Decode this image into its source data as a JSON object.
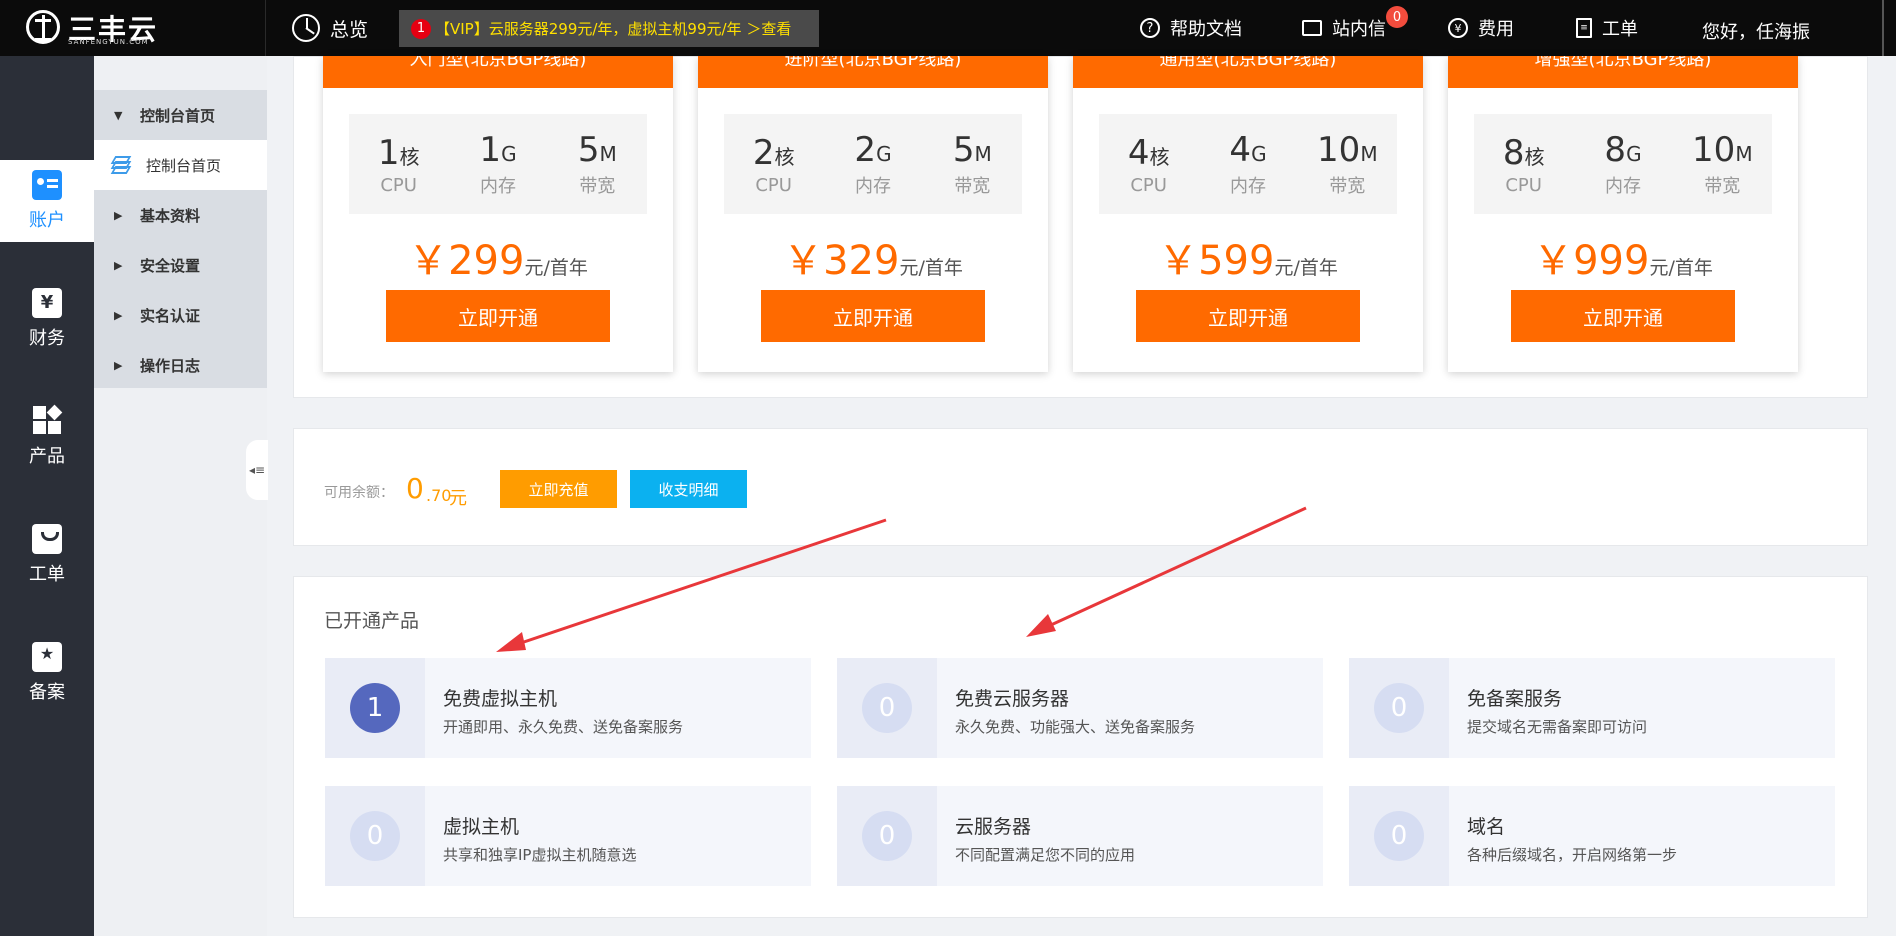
{
  "topbar": {
    "logo_text": "三丰云",
    "logo_sub": "SANFENGYUN.COM",
    "overview": "总览",
    "notice": {
      "badge": "1",
      "text": "【VIP】云服务器299元/年，虚拟主机99元/年 ＞查看"
    },
    "help": "帮助文档",
    "messages": "站内信",
    "messages_badge": "0",
    "fees": "费用",
    "tickets": "工单",
    "greeting": "您好，任海振",
    "icons": {
      "help": "help-circle-icon",
      "messages": "mail-icon",
      "fees": "yen-circle-icon",
      "tickets": "document-icon",
      "overview": "pie-chart-icon"
    }
  },
  "rail": [
    {
      "label": "账户",
      "icon": "account-card-icon",
      "active": true
    },
    {
      "label": "财务",
      "icon": "yen-wallet-icon",
      "active": false
    },
    {
      "label": "产品",
      "icon": "product-grid-icon",
      "active": false
    },
    {
      "label": "工单",
      "icon": "ticket-bag-icon",
      "active": false
    },
    {
      "label": "备案",
      "icon": "record-star-icon",
      "active": false
    }
  ],
  "submenu": {
    "header": "控制台首页",
    "items": [
      "控制台首页",
      "基本资料",
      "安全设置",
      "实名认证",
      "操作日志"
    ]
  },
  "plans": [
    {
      "title": "入门型(北京BGP线路)",
      "cpu": "1",
      "cpu_unit": "核",
      "mem": "1",
      "mem_unit": "G",
      "bw": "5",
      "bw_unit": "M",
      "price": "299"
    },
    {
      "title": "进阶型(北京BGP线路)",
      "cpu": "2",
      "cpu_unit": "核",
      "mem": "2",
      "mem_unit": "G",
      "bw": "5",
      "bw_unit": "M",
      "price": "329"
    },
    {
      "title": "通用型(北京BGP线路)",
      "cpu": "4",
      "cpu_unit": "核",
      "mem": "4",
      "mem_unit": "G",
      "bw": "10",
      "bw_unit": "M",
      "price": "599"
    },
    {
      "title": "增强型(北京BGP线路)",
      "cpu": "8",
      "cpu_unit": "核",
      "mem": "8",
      "mem_unit": "G",
      "bw": "10",
      "bw_unit": "M",
      "price": "999"
    }
  ],
  "plan_labels": {
    "cpu": "CPU",
    "mem": "内存",
    "bw": "带宽",
    "currency": "￥",
    "per": "元/首年",
    "button": "立即开通"
  },
  "balance": {
    "label": "可用余额：",
    "int": "0",
    "dec": ".70",
    "unit": "元",
    "recharge": "立即充值",
    "details": "收支明细"
  },
  "products_title": "已开通产品",
  "products": [
    {
      "count": "1",
      "title": "免费虚拟主机",
      "desc": "开通即用、永久免费、送免备案服务"
    },
    {
      "count": "0",
      "title": "免费云服务器",
      "desc": "永久免费、功能强大、送免备案服务"
    },
    {
      "count": "0",
      "title": "免备案服务",
      "desc": "提交域名无需备案即可访问"
    },
    {
      "count": "0",
      "title": "虚拟主机",
      "desc": "共享和独享IP虚拟主机随意选"
    },
    {
      "count": "0",
      "title": "云服务器",
      "desc": "不同配置满足您不同的应用"
    },
    {
      "count": "0",
      "title": "域名",
      "desc": "各种后缀域名，开启网络第一步"
    }
  ],
  "colors": {
    "accent": "#ff6a00",
    "active_blue": "#1e90ff",
    "recharge": "#ff9c00",
    "details": "#0bb1f0",
    "arrow": "#e8373a"
  }
}
